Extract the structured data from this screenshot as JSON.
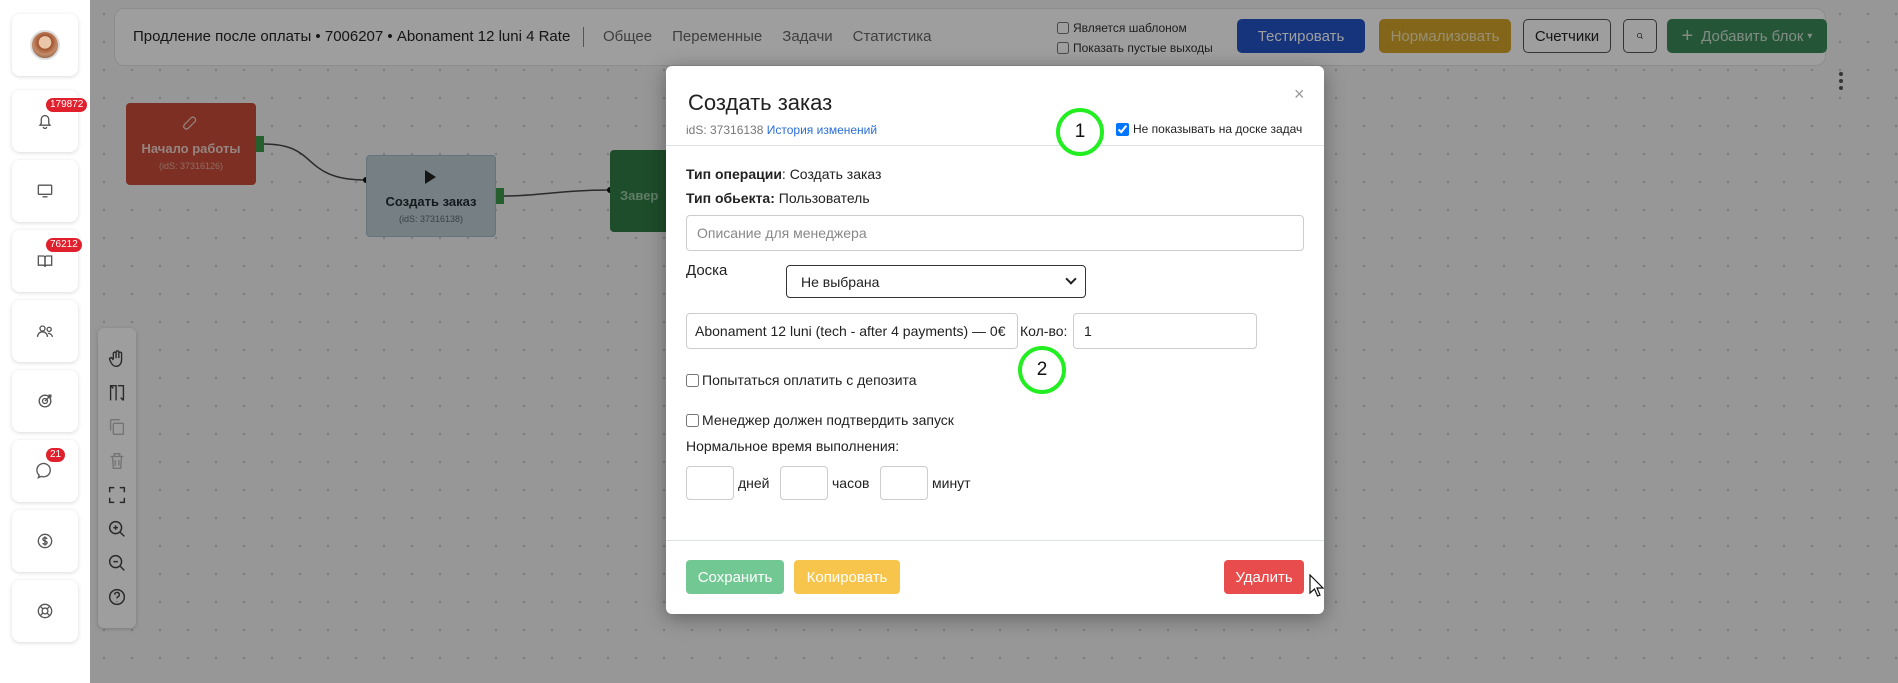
{
  "sidebar": {
    "items": [
      {
        "icon": "avatar",
        "badge": ""
      },
      {
        "icon": "bell-icon",
        "badge": "179872"
      },
      {
        "icon": "monitor-icon",
        "badge": ""
      },
      {
        "icon": "book-icon",
        "badge": "76212"
      },
      {
        "icon": "users-icon",
        "badge": ""
      },
      {
        "icon": "target-icon",
        "badge": ""
      },
      {
        "icon": "chat-icon",
        "badge": "21"
      },
      {
        "icon": "dollar-icon",
        "badge": ""
      },
      {
        "icon": "support-icon",
        "badge": ""
      }
    ]
  },
  "header": {
    "title": "Продление после оплаты • 7006207 • Abonament 12 luni 4 Rate",
    "tabs": [
      "Общее",
      "Переменные",
      "Задачи",
      "Статистика"
    ],
    "is_template_label": "Является шаблоном",
    "show_empty_label": "Показать пустые выходы",
    "test_label": "Тестировать",
    "normalize_label": "Нормализовать",
    "counters_label": "Счетчики",
    "add_block_label": "Добавить блок"
  },
  "flow": {
    "start_title": "Начало работы",
    "start_ids": "(idS: 37316126)",
    "order_title": "Создать заказ",
    "order_ids": "(idS: 37316138)",
    "end_title": "Завер"
  },
  "modal": {
    "title": "Создать заказ",
    "close": "×",
    "ids": "idS: 37316138",
    "history_link": "История изменений",
    "hide_on_board_label": "Не показывать на доске задач",
    "hide_on_board_checked": true,
    "operation_type_label": "Тип операции",
    "operation_type_value": ": Создать заказ",
    "object_type_label": "Тип обьекта:",
    "object_type_value": " Пользователь",
    "description_placeholder": "Описание для менеджера",
    "board_label": "Доска",
    "board_value": "Не выбрана",
    "product_value": "Abonament 12 luni (tech - after 4 payments) — 0€",
    "qty_label": "Кол-во:",
    "qty_value": "1",
    "deposit_label": "Попытаться оплатить с депозита",
    "confirm_label": "Менеджер должен подтвердить запуск",
    "time_label": "Нормальное время выполнения:",
    "days_label": "дней",
    "hours_label": "часов",
    "minutes_label": "минут",
    "save_label": "Сохранить",
    "copy_label": "Копировать",
    "delete_label": "Удалить"
  },
  "annotations": [
    "1",
    "2"
  ],
  "colors": {
    "test": "#2255c9",
    "normalize": "#d4a52a",
    "add": "#3d8a59",
    "save": "#72c893",
    "copy": "#f7c54c",
    "delete": "#e84c4c",
    "annotation": "#22ee22"
  }
}
